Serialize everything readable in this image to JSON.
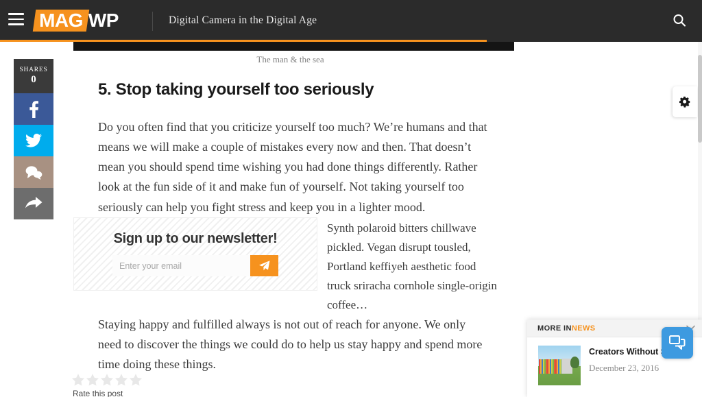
{
  "header": {
    "menu_icon": "hamburger-menu-icon",
    "logo_primary": "MAG",
    "logo_secondary": "WP",
    "site_title": "Digital Camera in the Digital Age",
    "search_icon": "search-icon",
    "background_color": "#2b2b2b",
    "accent_color": "#f6921e",
    "reading_progress_percent": 69
  },
  "share_rail": {
    "count_label": "SHARES",
    "count_value": "0",
    "buttons": [
      {
        "name": "facebook",
        "icon": "facebook-icon",
        "color": "#3b5998"
      },
      {
        "name": "twitter",
        "icon": "twitter-icon",
        "color": "#00aced"
      },
      {
        "name": "comments",
        "icon": "comment-bubble-icon",
        "color": "#a89182"
      },
      {
        "name": "share",
        "icon": "share-arrow-icon",
        "color": "#6d6d6d"
      }
    ]
  },
  "article": {
    "image_caption": "The man & the sea",
    "heading": "5. Stop taking yourself too seriously",
    "paragraph_1": "Do you often find that you criticize yourself too much? We’re humans and that means we will make a couple of mistakes every now and then. That doesn’t mean you should spend time wishing you had done things differently. Rather look at the fun side of it and make fun of yourself. Not taking yourself too seriously can help you fight stress and keep you in a lighter mood.",
    "aside_text": "Synth polaroid bitters chillwave pickled. Vegan disrupt tousled, Portland keffiyeh aesthetic food truck sriracha cornhole single-origin coffee…",
    "paragraph_2": "Staying happy and fulfilled always is not out of reach for anyone. We only need to discover the things we could do to help us stay happy and spend more time doing these things."
  },
  "newsletter": {
    "heading": "Sign up to our newsletter!",
    "placeholder": "Enter your email",
    "value": "",
    "submit_icon": "paper-plane-icon",
    "submit_color": "#f6921e"
  },
  "rating": {
    "label": "Rate this post",
    "stars_total": 5,
    "stars_selected": 0,
    "star_icon": "star-icon",
    "star_color": "#e8e8e8"
  },
  "settings_tab": {
    "icon": "gear-icon"
  },
  "more_in": {
    "label_prefix": "MORE IN",
    "label_category": "NEWS",
    "close_icon": "chevron-down-icon",
    "item_title": "Creators Without S",
    "item_date": "December 23, 2016",
    "thumbnail_icon": "article-thumbnail-image"
  },
  "chat": {
    "icon": "chat-bubbles-icon",
    "color": "#3d9ae0"
  }
}
